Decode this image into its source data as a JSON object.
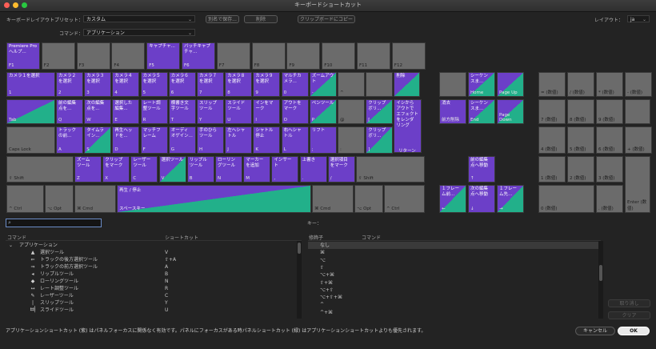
{
  "window": {
    "title": "キーボードショートカット"
  },
  "preset": {
    "label": "キーボードレイアウトプリセット：",
    "value": "カスタム"
  },
  "command": {
    "label": "コマンド：",
    "value": "アプリケーション"
  },
  "buttons": {
    "save_as": "別名で保存...",
    "delete": "削除",
    "copy_clipboard": "クリップボードにコピー",
    "undo": "取り消し",
    "clear": "クリア",
    "cancel": "キャンセル",
    "ok": "OK"
  },
  "layout": {
    "label": "レイアウト：",
    "value": "ja"
  },
  "keys": {
    "f": [
      {
        "cmd": "Premiere Pro\nヘルプ...",
        "kn": "F1",
        "t": "app"
      },
      {
        "cmd": "",
        "kn": "F2",
        "t": "none"
      },
      {
        "cmd": "",
        "kn": "F3",
        "t": "none"
      },
      {
        "cmd": "",
        "kn": "F4",
        "t": "none"
      },
      {
        "cmd": "キャプチャ...",
        "kn": "F5",
        "t": "app"
      },
      {
        "cmd": "バッチキャプ\nチャ...",
        "kn": "F6",
        "t": "app"
      },
      {
        "cmd": "",
        "kn": "F7",
        "t": "none"
      },
      {
        "cmd": "",
        "kn": "F8",
        "t": "none"
      },
      {
        "cmd": "",
        "kn": "F9",
        "t": "none"
      },
      {
        "cmd": "",
        "kn": "F10",
        "t": "none"
      },
      {
        "cmd": "",
        "kn": "F11",
        "t": "none"
      },
      {
        "cmd": "",
        "kn": "F12",
        "t": "none"
      }
    ],
    "num": [
      {
        "cmd": "カメラ１を選択",
        "kn": "1",
        "t": "app"
      },
      {
        "cmd": "カメラ２\nを選択",
        "kn": "2",
        "t": "app"
      },
      {
        "cmd": "カメラ３\nを選択",
        "kn": "3",
        "t": "app"
      },
      {
        "cmd": "カメラ４\nを選択",
        "kn": "4",
        "t": "app"
      },
      {
        "cmd": "カメラ５\nを選択",
        "kn": "5",
        "t": "app"
      },
      {
        "cmd": "カメラ６\nを選択",
        "kn": "6",
        "t": "app"
      },
      {
        "cmd": "カメラ７\nを選択",
        "kn": "7",
        "t": "app"
      },
      {
        "cmd": "カメラ８\nを選択",
        "kn": "8",
        "t": "app"
      },
      {
        "cmd": "カメラ９\nを選択",
        "kn": "9",
        "t": "app"
      },
      {
        "cmd": "マルチカ\nメラ...",
        "kn": "0",
        "t": "app"
      },
      {
        "cmd": "ズームアウ\nト",
        "kn": "-",
        "t": "both"
      },
      {
        "cmd": "",
        "kn": "^",
        "t": "none"
      },
      {
        "cmd": "",
        "kn": "",
        "t": "none"
      },
      {
        "cmd": "削除",
        "kn": "",
        "t": "both"
      }
    ],
    "tabrow": [
      {
        "cmd": "前の編集\n点を...",
        "kn": "Q",
        "t": "app"
      },
      {
        "cmd": "次の編集\n点を...",
        "kn": "W",
        "t": "app"
      },
      {
        "cmd": "選択した\n編集...",
        "kn": "E",
        "t": "app"
      },
      {
        "cmd": "レート調\n整ツール",
        "kn": "R",
        "t": "app"
      },
      {
        "cmd": "横書き文\n字ツール",
        "kn": "T",
        "t": "app"
      },
      {
        "cmd": "スリップ\nツール",
        "kn": "Y",
        "t": "app"
      },
      {
        "cmd": "スライド\nツール",
        "kn": "U",
        "t": "app"
      },
      {
        "cmd": "インをマ\nーク",
        "kn": "I",
        "t": "app"
      },
      {
        "cmd": "アウトを\nマーク",
        "kn": "O",
        "t": "app"
      },
      {
        "cmd": "ペンツール",
        "kn": "P",
        "t": "both"
      },
      {
        "cmd": "",
        "kn": "@",
        "t": "none"
      },
      {
        "cmd": "クリップ\nボリ...",
        "kn": "[",
        "t": "both"
      },
      {
        "cmd": "イシから\nアウトで\nエフェクト\nをレンダ\nリング",
        "kn": "",
        "t": "app"
      }
    ],
    "capsrow": [
      {
        "cmd": "トラック\nの前...",
        "kn": "A",
        "t": "app"
      },
      {
        "cmd": "タイムラ\nイン...",
        "kn": "S",
        "t": "both"
      },
      {
        "cmd": "再生ヘッ\nドを...",
        "kn": "D",
        "t": "app"
      },
      {
        "cmd": "マッチフ\nレーム",
        "kn": "F",
        "t": "app"
      },
      {
        "cmd": "オーディ\nオゲイン...",
        "kn": "G",
        "t": "app"
      },
      {
        "cmd": "手のひら\nツール",
        "kn": "H",
        "t": "app"
      },
      {
        "cmd": "左へシャ\nトル",
        "kn": "J",
        "t": "app"
      },
      {
        "cmd": "シャトル\n停止",
        "kn": "K",
        "t": "app"
      },
      {
        "cmd": "右へシャ\nトル",
        "kn": "L",
        "t": "app"
      },
      {
        "cmd": "リフト",
        "kn": ";",
        "t": "app"
      },
      {
        "cmd": "",
        "kn": ":",
        "t": "none"
      },
      {
        "cmd": "クリップ\nボリ...",
        "kn": "]",
        "t": "both"
      },
      {
        "cmd": "リターン",
        "kn": "",
        "t": "app"
      }
    ],
    "shiftrow": [
      {
        "cmd": "ズーム\nツール",
        "kn": "Z",
        "t": "app"
      },
      {
        "cmd": "クリップ\nをマーク",
        "kn": "X",
        "t": "app"
      },
      {
        "cmd": "レーザー\nツール",
        "kn": "C",
        "t": "app"
      },
      {
        "cmd": "選択ツール",
        "kn": "V",
        "t": "both"
      },
      {
        "cmd": "リップル\nツール",
        "kn": "B",
        "t": "app"
      },
      {
        "cmd": "ローリン\nグツール",
        "kn": "N",
        "t": "app"
      },
      {
        "cmd": "マーカー\nを追加",
        "kn": "M",
        "t": "app"
      },
      {
        "cmd": "インサー\nト",
        "kn": ",",
        "t": "app"
      },
      {
        "cmd": "上書き",
        "kn": ".",
        "t": "app"
      },
      {
        "cmd": "選択項目\nをマーク",
        "kn": "/",
        "t": "app"
      },
      {
        "cmd": "",
        "kn": "",
        "t": "none"
      }
    ],
    "mods": {
      "tab": "Tab",
      "caps": "Caps Lock",
      "lshift": "⇧ Shift",
      "rshift": "⇧ Shift",
      "lctrl": "^ Ctrl",
      "lopt": "⌥ Opt",
      "lcmd": "⌘ Cmd",
      "rcmd": "⌘ Cmd",
      "ropt": "⌥ Opt",
      "rctrl": "^ Ctrl"
    },
    "space": {
      "cmd": "再生 / 停止",
      "kn": "スペースキー"
    },
    "nav": [
      {
        "cmd": "",
        "kn": "",
        "t": "none"
      },
      {
        "cmd": "",
        "kn": "Home",
        "t": "none"
      },
      {
        "cmd": "",
        "kn": "Page Up",
        "t": "both"
      },
      {
        "cmd": "消去",
        "kn": "前方削除",
        "t": "app"
      },
      {
        "cmd": "シーケン\nスま...",
        "kn": "End",
        "t": "both"
      },
      {
        "cmd": "",
        "kn": "Page\nDown",
        "t": "both"
      }
    ],
    "navtop": [
      {
        "cmd": "シーケン\nスま...",
        "kn": "Home",
        "t": "both"
      }
    ],
    "arrows": [
      {
        "cmd": "前の編集\n点へ移動",
        "kn": "↑",
        "t": "app"
      },
      {
        "cmd": "１フレー\nム前...",
        "kn": "←",
        "t": "both"
      },
      {
        "cmd": "次の編集\n点へ移動",
        "kn": "↓",
        "t": "app"
      },
      {
        "cmd": "１フレー\nム先...",
        "kn": "→",
        "t": "both"
      }
    ],
    "numpad": [
      "",
      "",
      "",
      "",
      "= (数値)",
      "/ (数値)",
      "* (数値)",
      "- (数値)",
      "7 (数値)",
      "8 (数値)",
      "9 (数値)",
      "",
      "4 (数値)",
      "5 (数値)",
      "6 (数値)",
      "+ (数値)",
      "1 (数値)",
      "2 (数値)",
      "3 (数値)",
      "Enter (数値)",
      "0 (数値)",
      ". (数値)"
    ]
  },
  "keys_label": "キー：",
  "table": {
    "headers": [
      "コマンド",
      "ショートカット"
    ],
    "group": "アプリケーション",
    "rows": [
      {
        "name": "選択ツール",
        "sc": "V",
        "icon": "▲"
      },
      {
        "name": "トラックの後方選択ツール",
        "sc": "⇧+A",
        "icon": "⇐"
      },
      {
        "name": "トラックの前方選択ツール",
        "sc": "A",
        "icon": "⇒"
      },
      {
        "name": "リップルツール",
        "sc": "B",
        "icon": "◂"
      },
      {
        "name": "ローリングツール",
        "sc": "N",
        "icon": "◆"
      },
      {
        "name": "レート調整ツール",
        "sc": "R",
        "icon": "↔"
      },
      {
        "name": "レーザーツール",
        "sc": "C",
        "icon": "✎"
      },
      {
        "name": "スリップツール",
        "sc": "Y",
        "icon": "|↔|"
      },
      {
        "name": "スライドツール",
        "sc": "U",
        "icon": "↔|"
      }
    ]
  },
  "modifiers": {
    "headers": [
      "修飾子",
      "コマンド"
    ],
    "rows": [
      "なし",
      "⌘",
      "⌥",
      "⇧",
      "⌥+⌘",
      "⇧+⌘",
      "⌥+⇧",
      "⌥+⇧+⌘",
      "^",
      "^+⌘"
    ]
  },
  "footer": {
    "note": "アプリケーションショートカット (紫) はパネルフォーカスに関係なく有効です。パネルにフォーカスがある時パネルショートカット (緑) はアプリケーションショートカットよりも優先されます。"
  },
  "colors": {
    "app": "#6c3fc8",
    "panel": "#22b08a",
    "key": "#6b6b6b"
  }
}
